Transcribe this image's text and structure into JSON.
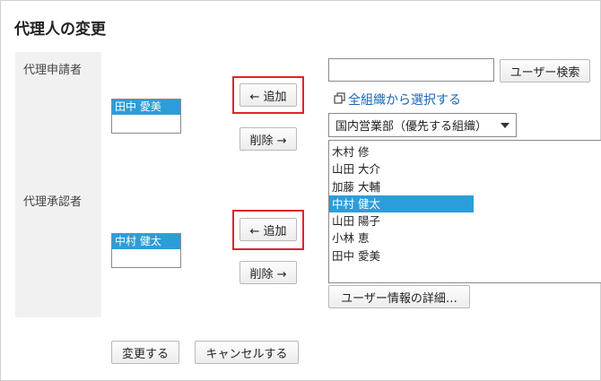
{
  "title": "代理人の変更",
  "applicant_section": {
    "label": "代理申請者",
    "selected_user": "田中 愛美",
    "add_button": "← 追加",
    "remove_button": "削除 →"
  },
  "approver_section": {
    "label": "代理承認者",
    "selected_user": "中村 健太",
    "add_button": "← 追加",
    "remove_button": "削除 →"
  },
  "search": {
    "input_value": "",
    "search_button": "ユーザー検索"
  },
  "org_link": "全組織から選択する",
  "org_select": {
    "selected": "国内営業部（優先する組織）"
  },
  "user_list": {
    "items": [
      "木村 修",
      "山田 大介",
      "加藤 大輔",
      "中村 健太",
      "山田 陽子",
      "小林 恵",
      "田中 愛美"
    ],
    "selected_index": 3
  },
  "user_detail_button": "ユーザー情報の詳細…",
  "footer": {
    "submit_button": "変更する",
    "cancel_button": "キャンセルする"
  },
  "colors": {
    "selection": "#2d9dd9",
    "highlight": "#e0242a",
    "link": "#1a66b8"
  }
}
